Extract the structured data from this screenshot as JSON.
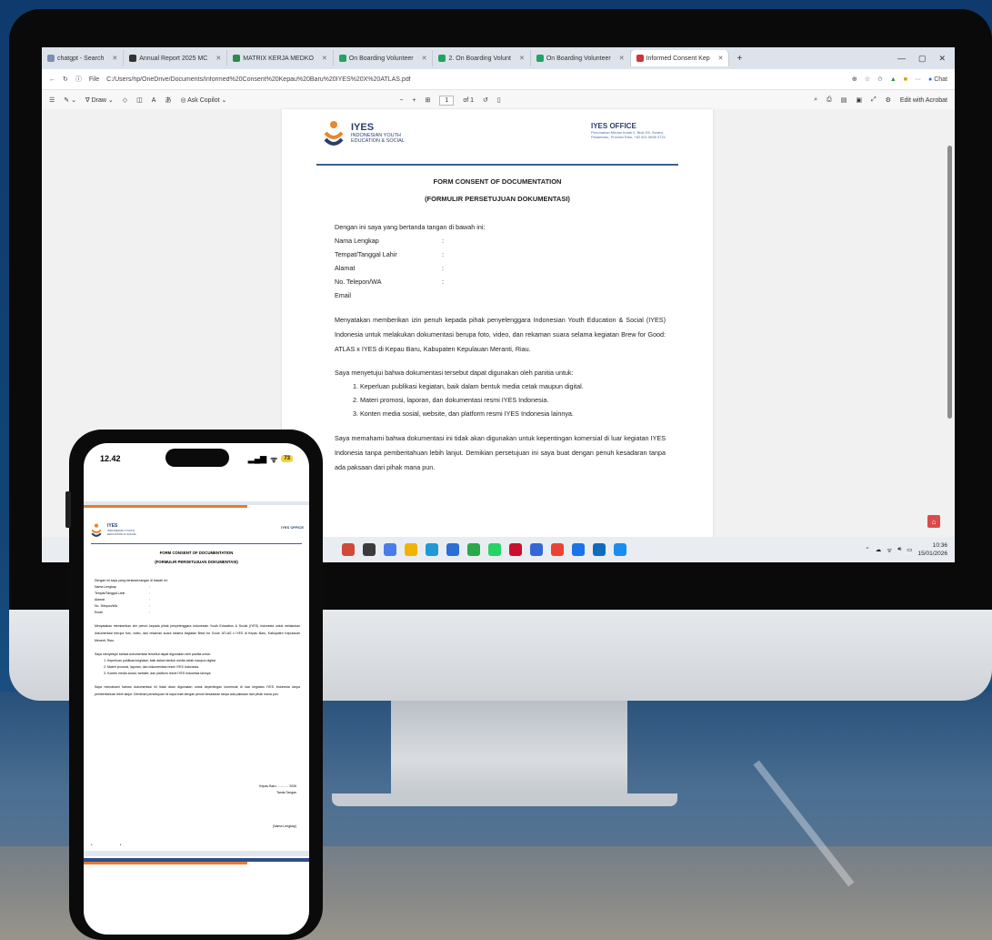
{
  "browser": {
    "tabs": [
      {
        "label": "chatgpt - Search",
        "color": "#7b8fb0"
      },
      {
        "label": "Annual Report 2025 MC",
        "color": "#333333"
      },
      {
        "label": "MATRIX KERJA MEDKO",
        "color": "#2e8b4a"
      },
      {
        "label": "On Boarding Volunteer",
        "color": "#1fa463"
      },
      {
        "label": "2. On Boarding Volunt",
        "color": "#1fa463"
      },
      {
        "label": "On Boarding Volunteer",
        "color": "#1fa463"
      },
      {
        "label": "Informed Consent Kep",
        "color": "#d13438"
      }
    ],
    "url": "C:/Users/hp/OneDrive/Documents/Informed%20Consent%20Kepau%20Baru%20IYES%20X%20ATLAS.pdf",
    "url_prefix": "File",
    "copilot": "Chat"
  },
  "pdf_toolbar": {
    "draw": "Draw",
    "ask_copilot": "Ask Copilot",
    "page_current": "1",
    "page_total": "of 1",
    "edit_acrobat": "Edit with Acrobat"
  },
  "document": {
    "logo_name": "IYES",
    "logo_sub1": "INDONESIAN YOUTH",
    "logo_sub2": "EDUCATION & SOCIAL",
    "office_title": "IYES OFFICE",
    "office_addr": "Perumahan Medan Indah II, Blok D5, Sentra, Pekanbaru, Provinsi Riau, +62 821 5695 3721",
    "title1": "FORM CONSENT OF DOCUMENTATION",
    "title2": "(FORMULIR PERSETUJUAN DOKUMENTASI)",
    "intro": "Dengan ini saya yang bertanda tangan di bawah ini:",
    "fields": [
      "Nama Lengkap",
      "Tempat/Tanggal Lahir",
      "Alamat",
      "No. Telepon/WA",
      "Email"
    ],
    "colon": ":",
    "para1": "Menyatakan memberikan izin penuh kepada pihak penyelenggara Indonesian Youth Education & Social (IYES) Indonesia untuk melakukan dokumentasi berupa foto, video, dan rekaman suara selama kegiatan Brew for Good: ATLAS x IYES di Kepau Baru, Kabupaten Kepulauan Meranti, Riau.",
    "para2": "Saya menyetujui bahwa dokumentasi tersebut dapat digunakan oleh panitia untuk:",
    "list": [
      "Keperluan publikasi kegiatan, baik dalam bentuk media cetak maupun digital.",
      "Materi promosi, laporan, dan dokumentasi resmi IYES Indonesia.",
      "Konten media sosial, website, dan platform resmi IYES Indonesia lainnya."
    ],
    "para3": "Saya memahami bahwa dokumentasi ini tidak akan digunakan untuk kepentingan komersial di luar kegiatan IYES Indonesia tanpa pemberitahuan lebih lanjut. Demikian persetujuan ini saya buat dengan penuh kesadaran tanpa ada paksaan dari pihak mana pun.",
    "sign_place": "Kepau Baru, ............ 2026",
    "sign_label": "Tanda Tangan",
    "sign_name": "(Nama Lengkap)"
  },
  "taskbar": {
    "time": "10:36",
    "date": "15/01/2026"
  },
  "phone": {
    "time": "12.42",
    "battery": "73"
  }
}
